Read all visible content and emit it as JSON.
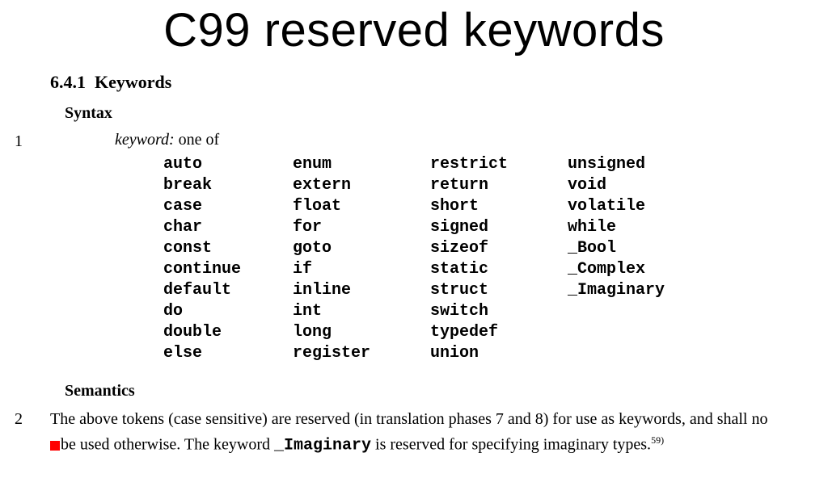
{
  "title": "C99 reserved keywords",
  "section": {
    "number": "6.4.1",
    "name": "Keywords"
  },
  "syntax": {
    "heading": "Syntax",
    "para_num": "1",
    "intro_term": "keyword:",
    "intro_rest": "  one of",
    "keywords": {
      "col1": [
        "auto",
        "break",
        "case",
        "char",
        "const",
        "continue",
        "default",
        "do",
        "double",
        "else"
      ],
      "col2": [
        "enum",
        "extern",
        "float",
        "for",
        "goto",
        "if",
        "inline",
        "int",
        "long",
        "register"
      ],
      "col3": [
        "restrict",
        "return",
        "short",
        "signed",
        "sizeof",
        "static",
        "struct",
        "switch",
        "typedef",
        "union"
      ],
      "col4": [
        "unsigned",
        "void",
        "volatile",
        "while",
        "_Bool",
        "_Complex",
        "_Imaginary",
        "",
        "",
        ""
      ]
    }
  },
  "semantics": {
    "heading": "Semantics",
    "para_num": "2",
    "text_before_cursor": "The above tokens (case sensitive) are reserved (in translation phases 7 and 8) for use as keywords, and shall no",
    "text_after_cursor": "be used otherwise.  The keyword ",
    "mono_keyword": "_Imaginary",
    "text_end": " is reserved for specifying imaginary types.",
    "footnote": "59)"
  }
}
